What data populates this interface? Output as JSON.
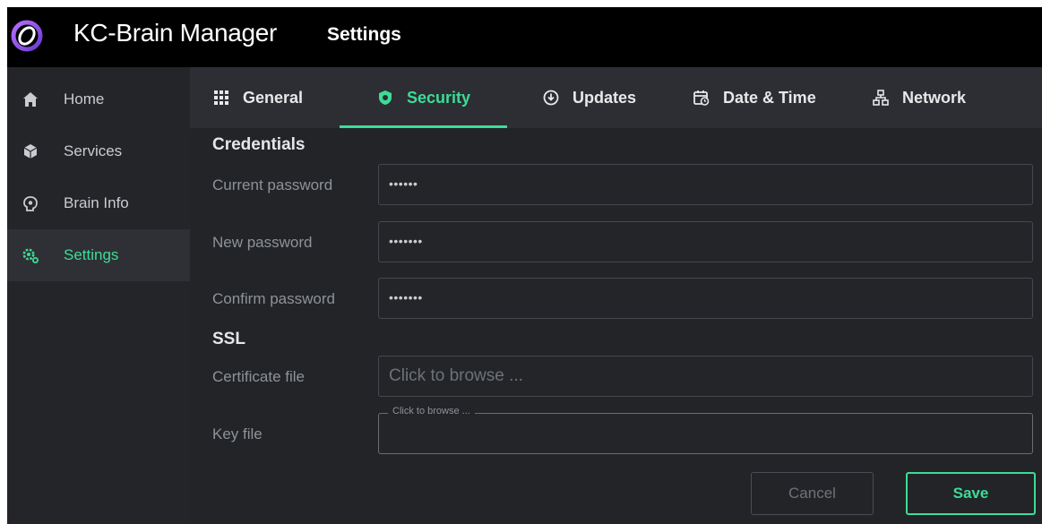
{
  "app": {
    "title": "KC-Brain Manager",
    "page_title": "Settings",
    "accent_color": "#3ddc97",
    "logo_icon": "kc-brain-ring-logo"
  },
  "sidebar": {
    "items": [
      {
        "label": "Home",
        "icon": "home-icon",
        "active": false
      },
      {
        "label": "Services",
        "icon": "cube-icon",
        "active": false
      },
      {
        "label": "Brain Info",
        "icon": "brain-icon",
        "active": false
      },
      {
        "label": "Settings",
        "icon": "settings-gear-icon",
        "active": true
      }
    ]
  },
  "tabs": [
    {
      "label": "General",
      "icon": "grid-icon",
      "active": false
    },
    {
      "label": "Security",
      "icon": "shield-icon",
      "active": true
    },
    {
      "label": "Updates",
      "icon": "download-circle-icon",
      "active": false
    },
    {
      "label": "Date & Time",
      "icon": "calendar-clock-icon",
      "active": false
    },
    {
      "label": "Network",
      "icon": "network-icon",
      "active": false
    }
  ],
  "credentials": {
    "section_title": "Credentials",
    "current_password_label": "Current password",
    "current_password_value": "••••••",
    "new_password_label": "New password",
    "new_password_value": "•••••••",
    "confirm_password_label": "Confirm password",
    "confirm_password_value": "•••••••"
  },
  "ssl": {
    "section_title": "SSL",
    "certificate_label": "Certificate file",
    "certificate_placeholder": "Click to browse ...",
    "key_label": "Key file",
    "key_placeholder": "Click to browse ..."
  },
  "actions": {
    "cancel_label": "Cancel",
    "save_label": "Save"
  }
}
